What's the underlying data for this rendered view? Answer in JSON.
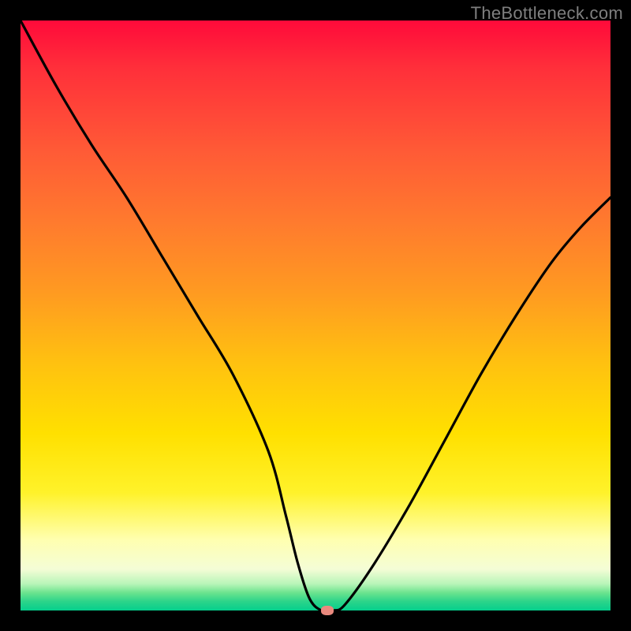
{
  "watermark": "TheBottleneck.com",
  "chart_data": {
    "type": "line",
    "title": "",
    "xlabel": "",
    "ylabel": "",
    "xlim": [
      0,
      100
    ],
    "ylim": [
      0,
      100
    ],
    "series": [
      {
        "name": "bottleneck-curve",
        "x": [
          0,
          6,
          12,
          18,
          24,
          30,
          36,
          42,
          45,
          47,
          49,
          51,
          53,
          55,
          60,
          66,
          72,
          78,
          84,
          90,
          95,
          100
        ],
        "values": [
          100,
          89,
          79,
          70,
          60,
          50,
          40,
          27,
          16,
          8,
          2,
          0,
          0,
          1,
          8,
          18,
          29,
          40,
          50,
          59,
          65,
          70
        ]
      }
    ],
    "annotations": [
      {
        "name": "optimal-point",
        "x": 52,
        "y": 0
      }
    ],
    "background_gradient": {
      "stops": [
        {
          "pos": 0,
          "color": "#ff0a3a"
        },
        {
          "pos": 0.22,
          "color": "#ff5a36"
        },
        {
          "pos": 0.46,
          "color": "#ff9a21"
        },
        {
          "pos": 0.7,
          "color": "#ffe000"
        },
        {
          "pos": 0.88,
          "color": "#ffffb0"
        },
        {
          "pos": 1.0,
          "color": "#05cf8c"
        }
      ]
    }
  }
}
